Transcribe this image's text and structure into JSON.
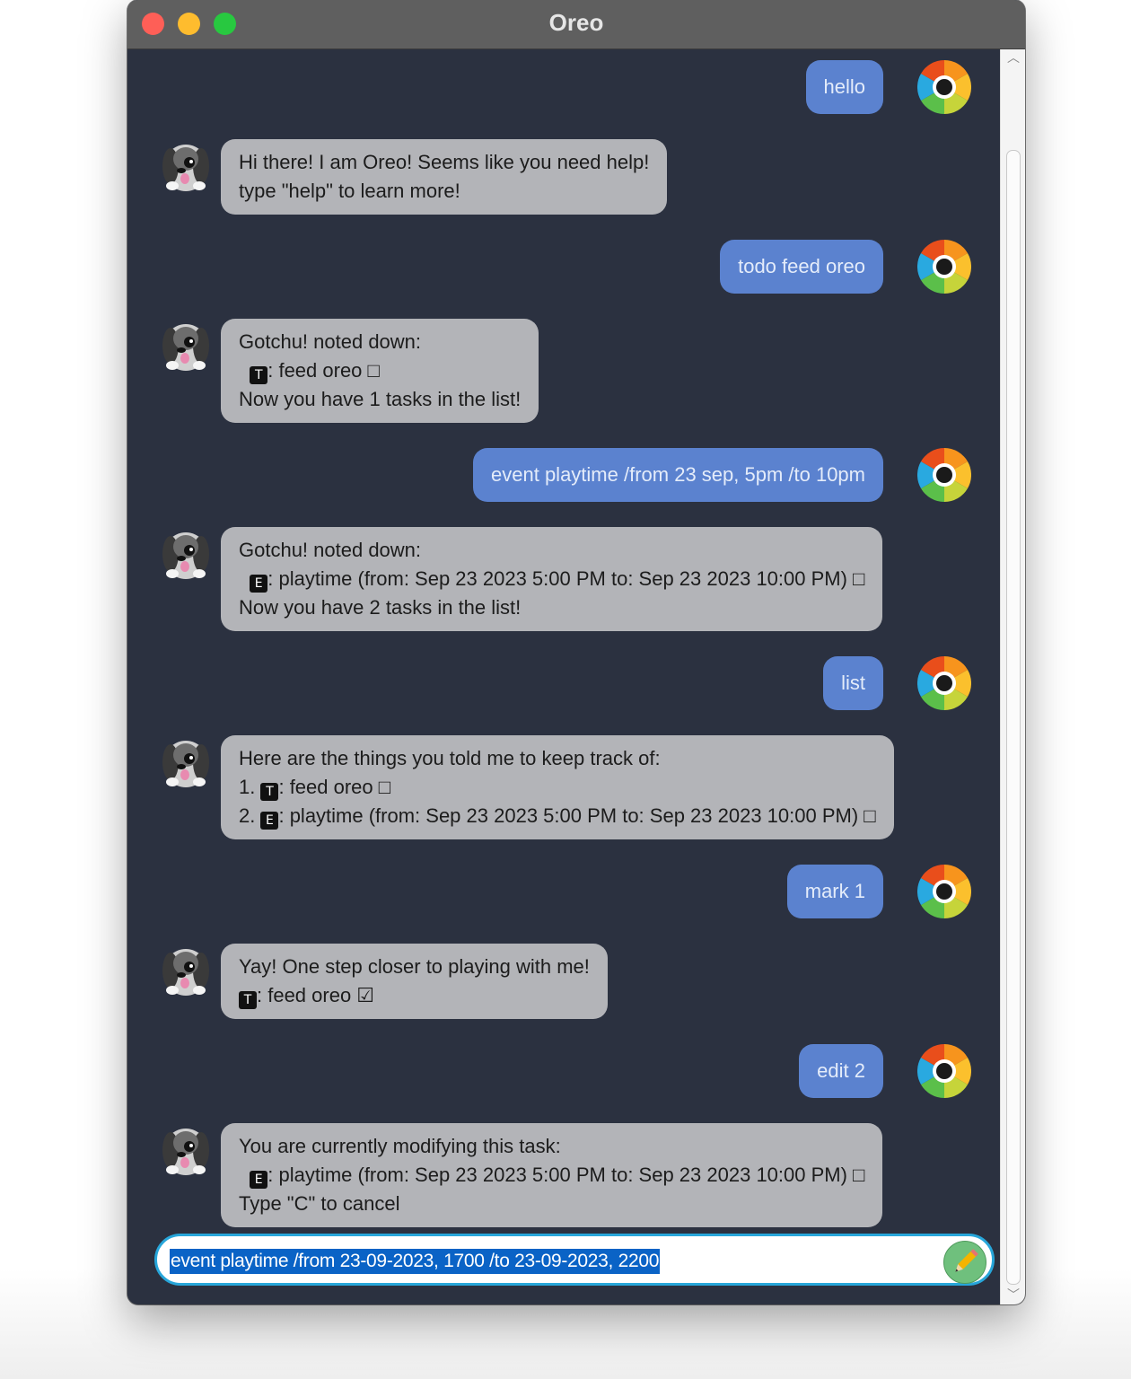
{
  "window": {
    "title": "Oreo"
  },
  "colors": {
    "chat_bg": "#2b3140",
    "user_bubble": "#5b82cf",
    "bot_bubble": "#b3b4b8",
    "input_border": "#27a6da",
    "send_button": "#6fc07d"
  },
  "messages": [
    {
      "sender": "user",
      "lines": [
        "hello"
      ]
    },
    {
      "sender": "bot",
      "lines": [
        "Hi there! I am Oreo! Seems like you need help!",
        "type \"help\" to learn more!"
      ]
    },
    {
      "sender": "user",
      "lines": [
        "todo feed oreo"
      ]
    },
    {
      "sender": "bot",
      "lines": [
        "Gotchu! noted down:",
        ":  feed oreo □",
        "Now you have 1 tasks in the list!"
      ],
      "tags": [
        "T"
      ]
    },
    {
      "sender": "user",
      "lines": [
        "event playtime /from 23 sep, 5pm /to 10pm"
      ]
    },
    {
      "sender": "bot",
      "lines": [
        "Gotchu! noted down:",
        ":  playtime (from:  Sep 23 2023 5:00 PM to:  Sep 23 2023 10:00 PM) □",
        "Now you have 2 tasks in the list!"
      ],
      "tags": [
        "E"
      ]
    },
    {
      "sender": "user",
      "lines": [
        "list"
      ]
    },
    {
      "sender": "bot",
      "lines": [
        "Here are the things you told me to keep track of:",
        ":  feed oreo □",
        ":  playtime (from:  Sep 23 2023 5:00 PM to:  Sep 23 2023 10:00 PM) □"
      ],
      "prefixes": [
        "1. ",
        "2. "
      ],
      "tags": [
        "T",
        "E"
      ]
    },
    {
      "sender": "user",
      "lines": [
        "mark 1"
      ]
    },
    {
      "sender": "bot",
      "lines": [
        "Yay! One step closer to playing with me!",
        ":  feed oreo ☑"
      ],
      "tags": [
        "T"
      ]
    },
    {
      "sender": "user",
      "lines": [
        "edit 2"
      ]
    },
    {
      "sender": "bot",
      "lines": [
        "You are currently modifying this task:",
        ":  playtime (from:  Sep 23 2023 5:00 PM to:  Sep 23 2023 10:00 PM) □",
        "Type \"C\" to cancel"
      ],
      "tags": [
        "E"
      ]
    }
  ],
  "input": {
    "value": "event playtime /from 23-09-2023, 1700 /to 23-09-2023, 2200",
    "selected": true
  },
  "icons": {
    "user_avatar": "ring-avatar-icon",
    "bot_avatar": "dog-avatar-icon",
    "send": "pencil-icon"
  }
}
